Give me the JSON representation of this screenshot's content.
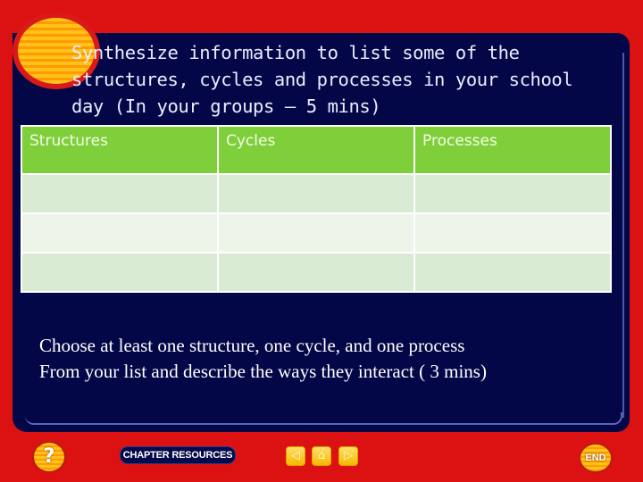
{
  "slide": {
    "title": "Synthesize information to list some of the\nstructures, cycles and processes in your school\nday (In your groups – 5 mins)",
    "table": {
      "headers": [
        "Structures",
        "Cycles",
        "Processes"
      ],
      "rows": [
        [
          "",
          "",
          ""
        ],
        [
          "",
          "",
          ""
        ],
        [
          "",
          "",
          ""
        ]
      ]
    },
    "instructions": {
      "line1": "Choose at least one structure, one cycle, and one process",
      "line2": "From your list and describe the ways they interact ( 3 mins)"
    }
  },
  "footer": {
    "help_label": "?",
    "chapter_resources_label": "CHAPTER RESOURCES",
    "prev_icon": "◁",
    "home_icon": "⌂",
    "next_icon": "▷",
    "end_label": "END"
  },
  "colors": {
    "background": "#dc1212",
    "panel": "#030747",
    "table_header": "#7fcf3a",
    "row_odd": "#d9ebd2",
    "row_even": "#edf5ea"
  }
}
